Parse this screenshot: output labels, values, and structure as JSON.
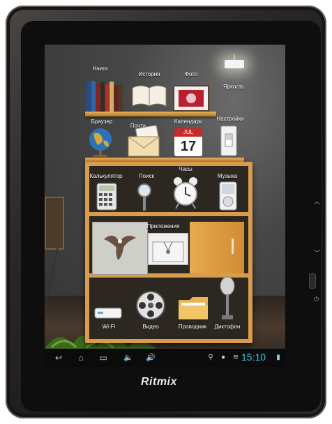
{
  "brand": "Ritmix",
  "apps": {
    "books": "Книги",
    "history": "История",
    "photo": "Фото",
    "brightness": "Яркость",
    "browser": "Браузер",
    "mail": "Почта",
    "calendar": "Календарь",
    "settings": "Настройки",
    "calculator": "Калькулятор",
    "search": "Поиск",
    "clock": "Часы",
    "music": "Музыка",
    "applications": "Приложения",
    "wifi": "Wi-Fi",
    "video": "Видео",
    "explorer": "Проводник",
    "recorder": "Диктофон"
  },
  "calendar_icon": {
    "month": "JUL",
    "day": "17"
  },
  "status_bar": {
    "time": "15:10"
  },
  "colors": {
    "shelf": "#d89c4c",
    "time": "#34c6ea",
    "wall": "#383838"
  }
}
